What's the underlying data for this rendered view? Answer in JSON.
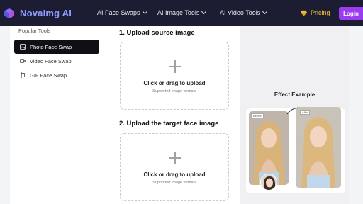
{
  "brand": {
    "name": "NovaImg AI"
  },
  "nav": {
    "items": [
      {
        "label": "AI Face Swaps"
      },
      {
        "label": "AI Image Tools"
      },
      {
        "label": "AI Video Tools"
      }
    ],
    "pricing": "Pricing",
    "login": "Login"
  },
  "sidebar": {
    "heading": "Popular Tools",
    "items": [
      {
        "label": "Photo Face Swap",
        "icon": "image-icon",
        "active": true
      },
      {
        "label": "Video Face Swap",
        "icon": "video-icon",
        "active": false
      },
      {
        "label": "GIF Face Swap",
        "icon": "gif-icon",
        "active": false
      }
    ]
  },
  "upload": {
    "source_title": "1. Upload source image",
    "target_title": "2. Upload the target face image",
    "cta": "Click or drag to upload",
    "hint": "Supported image formats"
  },
  "effect": {
    "title": "Effect Example",
    "before_tag": "Before",
    "after_tag": "After"
  },
  "colors": {
    "topbar": "#1c1d33",
    "brand": "#8e9bff",
    "pricing": "#f5c13b",
    "login": "#9b3cf0",
    "active_item": "#0f0f14"
  }
}
